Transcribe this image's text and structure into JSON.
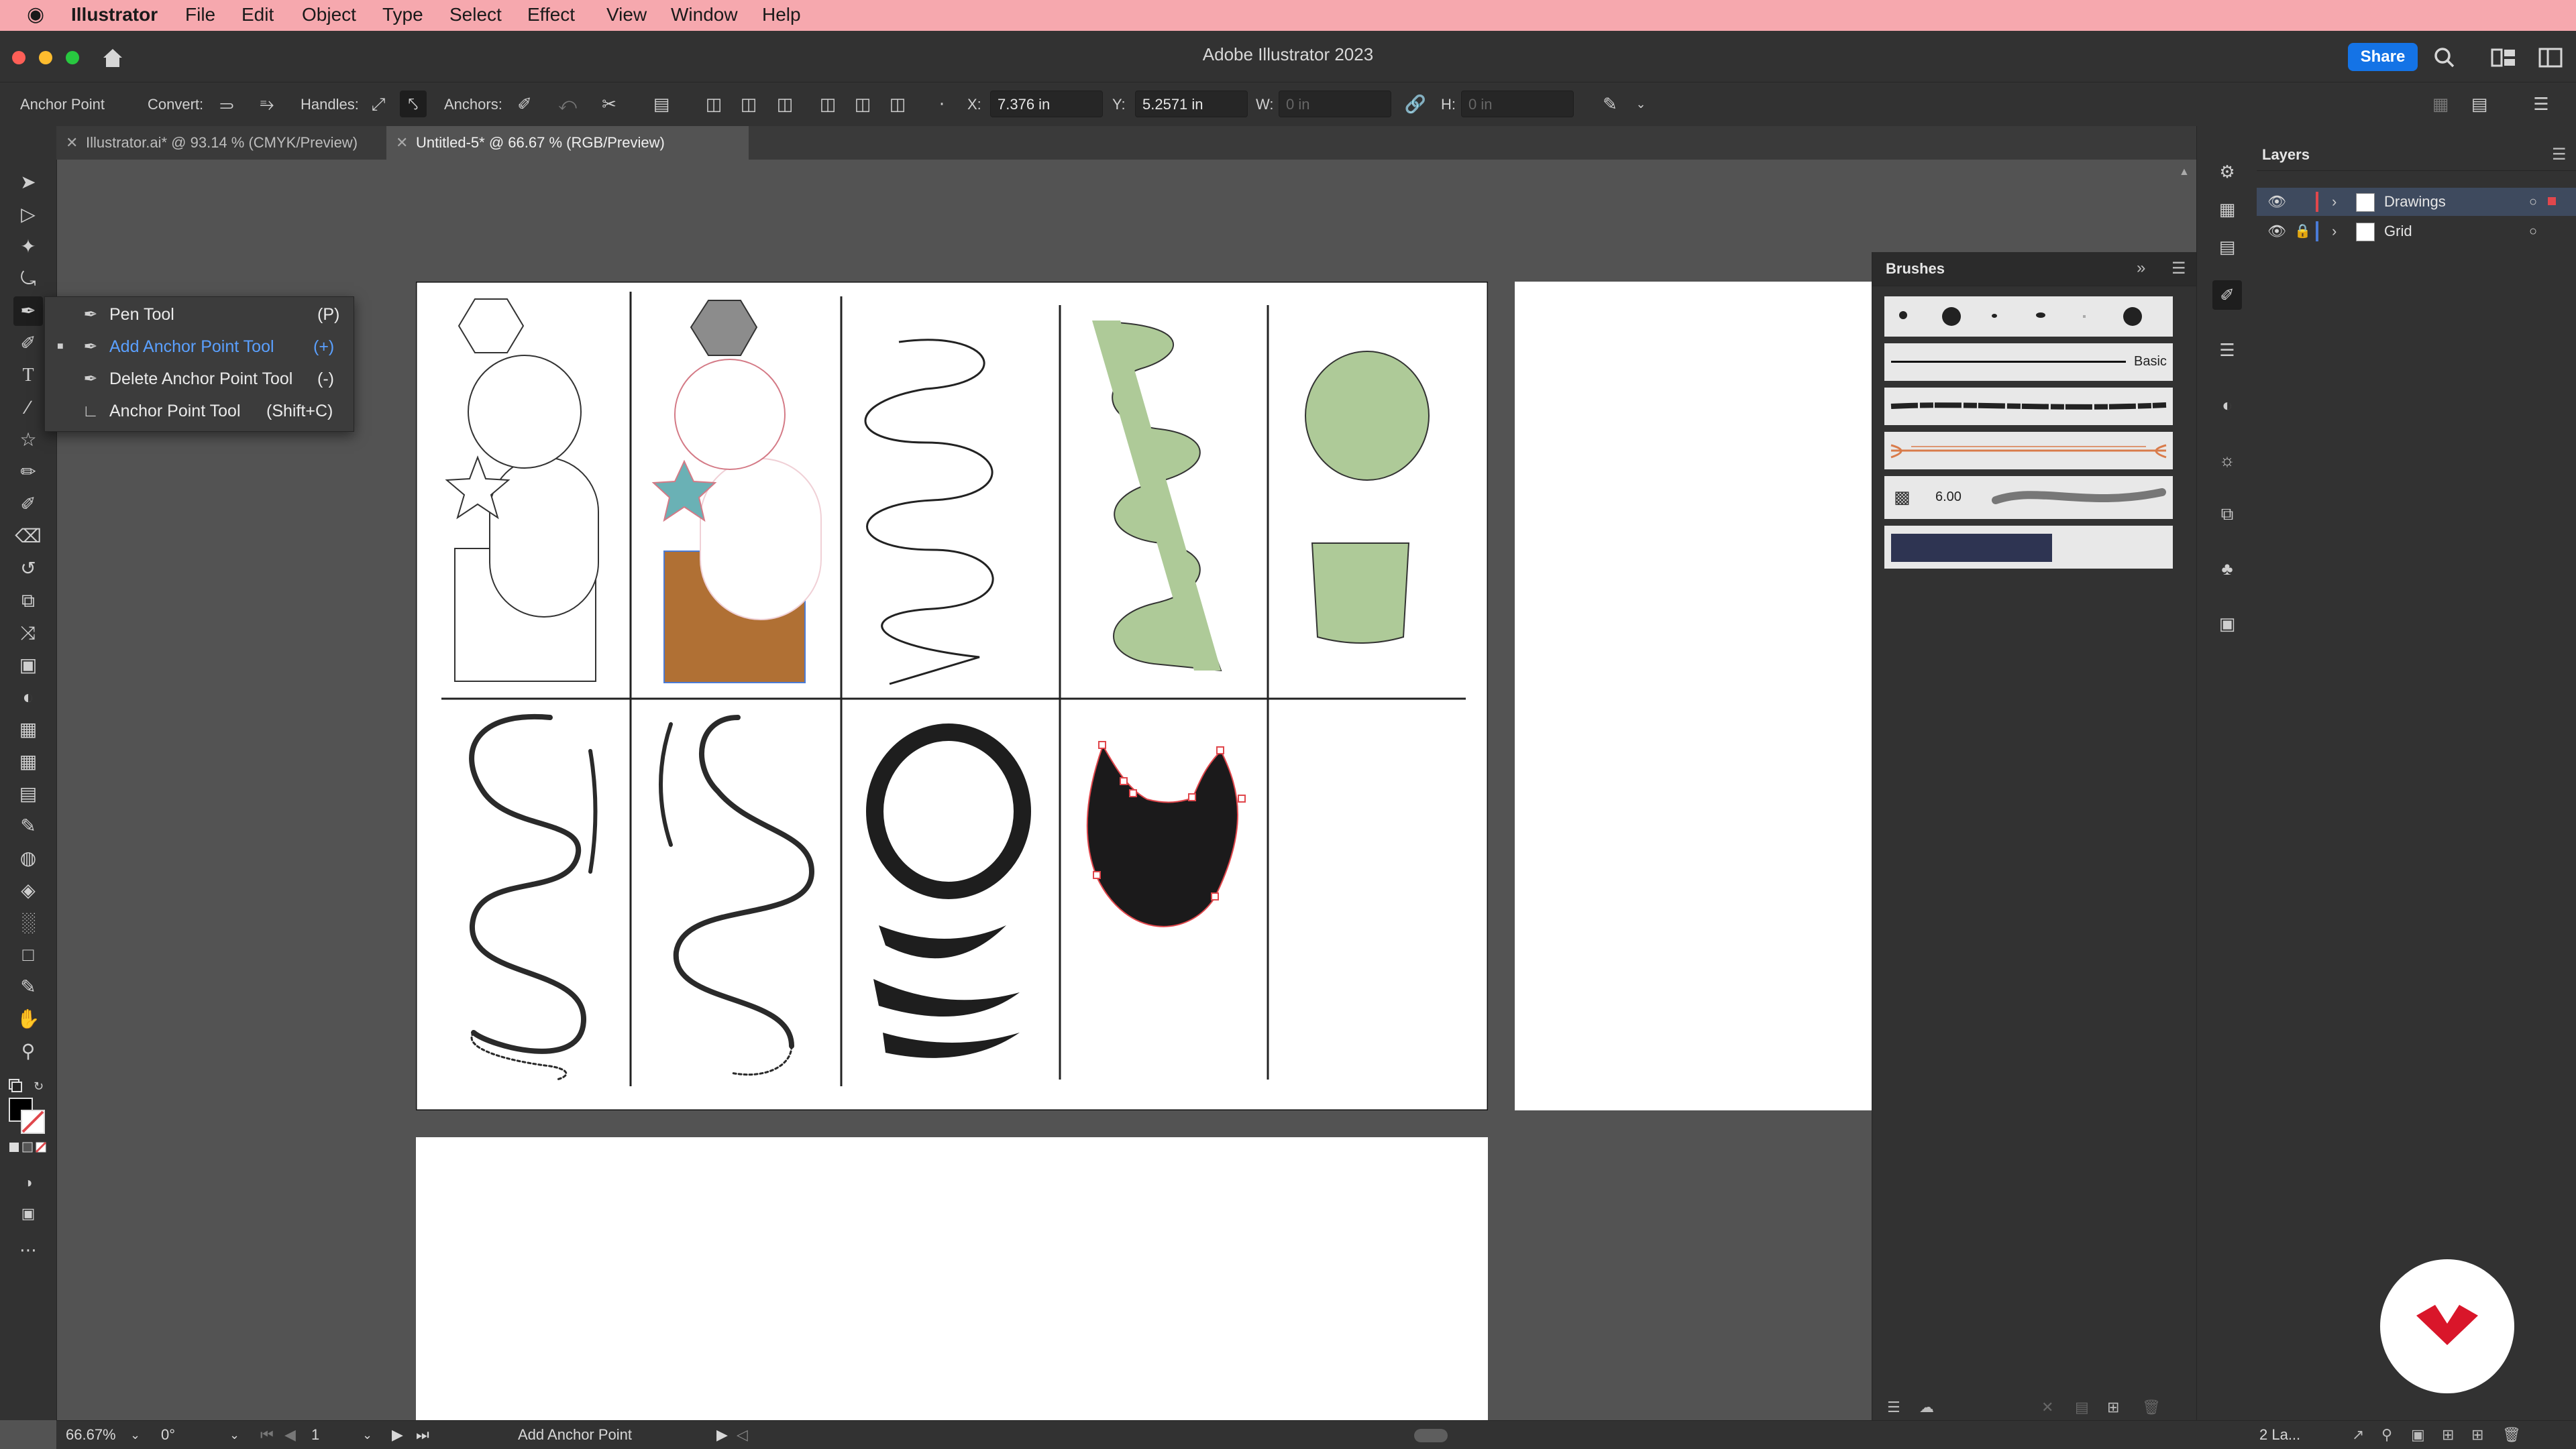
{
  "menubar": {
    "apple": "",
    "app_name": "Illustrator",
    "items": [
      "File",
      "Edit",
      "Object",
      "Type",
      "Select",
      "Effect",
      "View",
      "Window",
      "Help"
    ]
  },
  "titlebar": {
    "title": "Adobe Illustrator 2023",
    "share_label": "Share"
  },
  "controlbar": {
    "tool_name": "Anchor Point",
    "convert_label": "Convert:",
    "handles_label": "Handles:",
    "anchors_label": "Anchors:",
    "x_label": "X:",
    "x_value": "7.376 in",
    "y_label": "Y:",
    "y_value": "5.2571 in",
    "w_label": "W:",
    "w_value": "0 in",
    "h_label": "H:",
    "h_value": "0 in"
  },
  "tabs": [
    {
      "label": "Illustrator.ai* @ 93.14 % (CMYK/Preview)",
      "active": false
    },
    {
      "label": "Untitled-5* @ 66.67 % (RGB/Preview)",
      "active": true
    }
  ],
  "flyout": {
    "items": [
      {
        "label": "Pen Tool",
        "shortcut": "(P)",
        "selected": false
      },
      {
        "label": "Add Anchor Point Tool",
        "shortcut": "(+)",
        "selected": true
      },
      {
        "label": "Delete Anchor Point Tool",
        "shortcut": "(-)",
        "selected": false
      },
      {
        "label": "Anchor Point Tool",
        "shortcut": "(Shift+C)",
        "selected": false
      }
    ]
  },
  "brushes": {
    "title": "Brushes",
    "basic_label": "Basic",
    "size_value": "6.00"
  },
  "layers": {
    "title": "Layers",
    "items": [
      {
        "name": "Drawings",
        "color": "#e0474c"
      },
      {
        "name": "Grid",
        "color": "#4a7bd6"
      }
    ],
    "count_label": "2 La..."
  },
  "statusbar": {
    "zoom": "66.67%",
    "rotation": "0°",
    "artboard_number": "1",
    "current_tool": "Add Anchor Point"
  },
  "colors": {
    "accent_blue": "#1473e6",
    "selection_red": "#e0474c",
    "green_fill": "#aeca98",
    "brown_fill": "#b07034",
    "teal_star": "#6ab1b5",
    "hexagon_gray": "#8c8c8c"
  }
}
